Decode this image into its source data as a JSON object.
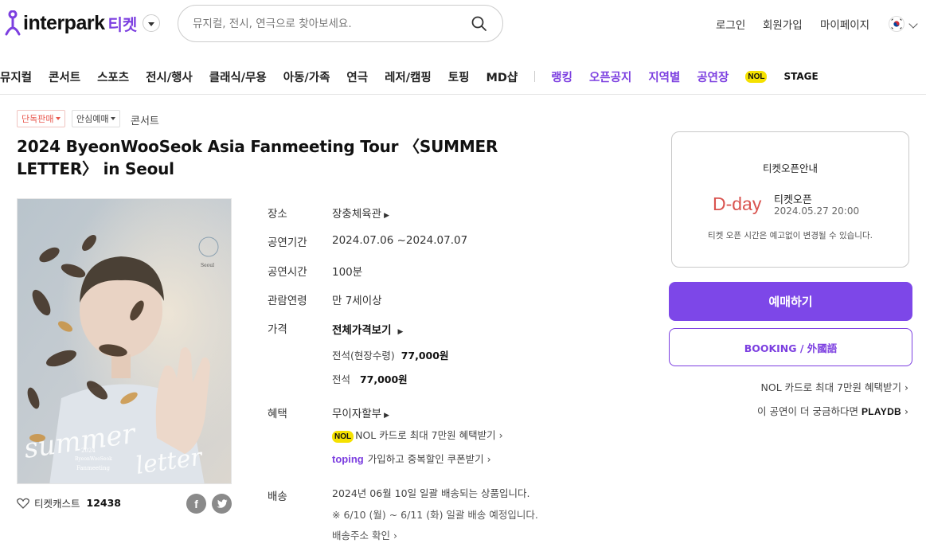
{
  "header": {
    "logo_text": "interpark",
    "logo_sub": "티켓",
    "search_placeholder": "뮤지컬, 전시, 연극으로 찾아보세요.",
    "login": "로그인",
    "signup": "회원가입",
    "mypage": "마이페이지"
  },
  "nav": {
    "items": [
      "뮤지컬",
      "콘서트",
      "스포츠",
      "전시/행사",
      "클래식/무용",
      "아동/가족",
      "연극",
      "레저/캠핑",
      "토핑",
      "MD샵"
    ],
    "purple_items": [
      "랭킹",
      "오픈공지",
      "지역별",
      "공연장"
    ],
    "nol_badge": "NOL",
    "stage": "STAGE"
  },
  "tags": {
    "exclusive": "단독판매",
    "safe": "안심예매",
    "genre": "콘서트"
  },
  "title": "2024 ByeonWooSeok Asia Fanmeeting Tour 〈SUMMER LETTER〉 in Seoul",
  "poster": {
    "script_text": "summer",
    "script_text2": "letter",
    "line1": "2024",
    "line2": "ByeonWooSeok",
    "line3": "Fanmeeting",
    "city": "Seoul"
  },
  "cast": {
    "label": "티켓캐스트",
    "count": "12438",
    "facebook": "f"
  },
  "info": {
    "venue_label": "장소",
    "venue": "장충체육관",
    "period_label": "공연기간",
    "period": "2024.07.06 ~2024.07.07",
    "runtime_label": "공연시간",
    "runtime": "100분",
    "age_label": "관람연령",
    "age": "만 7세이상",
    "price_label": "가격",
    "price_all": "전체가격보기",
    "price1_name": "전석(현장수령)",
    "price1_value": "77,000원",
    "price2_name": "전석",
    "price2_value": "77,000원",
    "benefit_label": "혜택",
    "benefit1": "무이자할부",
    "benefit2": "NOL 카드로 최대 7만원 혜택받기",
    "benefit3_brand": "toping",
    "benefit3": "가입하고 중복할인 쿠폰받기",
    "delivery_label": "배송",
    "delivery1": "2024년 06월 10일 일괄 배송되는 상품입니다.",
    "delivery2": "※ 6/10 (월) ~ 6/11 (화) 일괄 배송 예정입니다.",
    "delivery3": "배송주소 확인"
  },
  "open_box": {
    "title": "티켓오픈안내",
    "dday": "D-day",
    "label": "티켓오픈",
    "date": "2024.05.27 20:00",
    "note": "티켓 오픈 시간은 예고없이 변경될 수 있습니다."
  },
  "buttons": {
    "book": "예매하기",
    "english": "BOOKING / 外國語"
  },
  "links": {
    "nol_card": "NOL 카드로 최대 7만원 혜택받기",
    "more": "이 공연이 더 궁금하다면",
    "playdb": "PLAYDB"
  },
  "colors": {
    "accent": "#7d47e8",
    "dday": "#d9534f",
    "tag_red": "#e8574d"
  }
}
